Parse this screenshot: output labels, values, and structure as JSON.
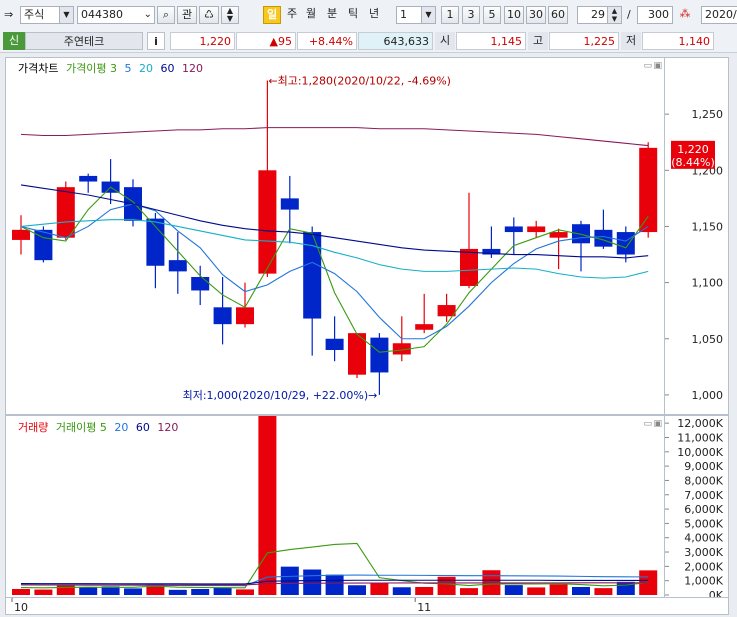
{
  "toolbar": {
    "market_select": "주식",
    "code_input": "044380",
    "search_label": "관",
    "period_buttons": [
      "일",
      "주",
      "월",
      "분",
      "틱",
      "년"
    ],
    "interval_select": "1",
    "interval_buttons": [
      "1",
      "3",
      "5",
      "10",
      "30",
      "60"
    ],
    "count_value": "29",
    "count_total_sep": "/",
    "count_total": "300",
    "date_field": "2020/"
  },
  "info": {
    "credit_badge": "신",
    "stock_name": "주연테크",
    "info_button": "i",
    "price": "1,220",
    "change": "▲95",
    "change_pct": "+8.44%",
    "volume": "643,633",
    "open_label": "시",
    "open": "1,145",
    "high_label": "고",
    "high": "1,225",
    "low_label": "저",
    "low": "1,140"
  },
  "colors": {
    "up": "#e8000b",
    "down": "#0025c8",
    "ma3": "#3a9a10",
    "ma5": "#2276d9",
    "ma20": "#14b0c8",
    "ma60": "#000a8c",
    "ma120": "#8a1a5a",
    "vol_ma5": "#3a9a10"
  },
  "price_panel": {
    "legend": [
      {
        "text": "가격차트",
        "color": "#000000"
      },
      {
        "text": "가격이평 3",
        "color": "#3a9a10"
      },
      {
        "text": "5",
        "color": "#2276d9"
      },
      {
        "text": "20",
        "color": "#14b0c8"
      },
      {
        "text": "60",
        "color": "#000a8c"
      },
      {
        "text": "120",
        "color": "#8a1a5a"
      }
    ],
    "max_annotation": "←최고:1,280(2020/10/22, -4.69%)",
    "min_annotation": "최저:1,000(2020/10/29, +22.00%)→",
    "last_price_label": "1,220",
    "last_pct_label": "(8.44%)"
  },
  "volume_panel": {
    "legend": [
      {
        "text": "거래량",
        "color": "#e8000b"
      },
      {
        "text": "거래이평 5",
        "color": "#3a9a10"
      },
      {
        "text": "20",
        "color": "#2276d9"
      },
      {
        "text": "60",
        "color": "#000a8c"
      },
      {
        "text": "120",
        "color": "#8a1a5a"
      }
    ]
  },
  "x_axis_labels": [
    {
      "text": "10",
      "index": 0
    },
    {
      "text": "11",
      "index": 18
    }
  ],
  "chart_data": [
    {
      "type": "candlestick",
      "title": "가격차트",
      "ylim": [
        983,
        1300
      ],
      "yticks": [
        1000,
        1050,
        1100,
        1150,
        1200,
        1250
      ],
      "ytick_labels": [
        "1,000",
        "1,050",
        "1,100",
        "1,150",
        "1,200",
        "1,250"
      ],
      "candles": [
        {
          "o": 1138,
          "h": 1160,
          "l": 1125,
          "c": 1147
        },
        {
          "o": 1147,
          "h": 1150,
          "l": 1118,
          "c": 1120
        },
        {
          "o": 1140,
          "h": 1190,
          "l": 1138,
          "c": 1185
        },
        {
          "o": 1195,
          "h": 1197,
          "l": 1180,
          "c": 1190
        },
        {
          "o": 1190,
          "h": 1210,
          "l": 1170,
          "c": 1180
        },
        {
          "o": 1185,
          "h": 1192,
          "l": 1150,
          "c": 1155
        },
        {
          "o": 1157,
          "h": 1162,
          "l": 1095,
          "c": 1115
        },
        {
          "o": 1120,
          "h": 1145,
          "l": 1090,
          "c": 1110
        },
        {
          "o": 1105,
          "h": 1115,
          "l": 1080,
          "c": 1093
        },
        {
          "o": 1078,
          "h": 1105,
          "l": 1045,
          "c": 1063
        },
        {
          "o": 1063,
          "h": 1100,
          "l": 1060,
          "c": 1078
        },
        {
          "o": 1108,
          "h": 1280,
          "l": 1105,
          "c": 1200
        },
        {
          "o": 1175,
          "h": 1195,
          "l": 1135,
          "c": 1165
        },
        {
          "o": 1145,
          "h": 1150,
          "l": 1035,
          "c": 1068
        },
        {
          "o": 1050,
          "h": 1070,
          "l": 1030,
          "c": 1040
        },
        {
          "o": 1018,
          "h": 1055,
          "l": 1015,
          "c": 1055
        },
        {
          "o": 1051,
          "h": 1055,
          "l": 1000,
          "c": 1020
        },
        {
          "o": 1036,
          "h": 1070,
          "l": 1030,
          "c": 1046
        },
        {
          "o": 1058,
          "h": 1090,
          "l": 1055,
          "c": 1063
        },
        {
          "o": 1070,
          "h": 1090,
          "l": 1065,
          "c": 1080
        },
        {
          "o": 1097,
          "h": 1180,
          "l": 1095,
          "c": 1130
        },
        {
          "o": 1130,
          "h": 1150,
          "l": 1122,
          "c": 1125
        },
        {
          "o": 1150,
          "h": 1158,
          "l": 1125,
          "c": 1145
        },
        {
          "o": 1145,
          "h": 1155,
          "l": 1140,
          "c": 1150
        },
        {
          "o": 1140,
          "h": 1148,
          "l": 1112,
          "c": 1145
        },
        {
          "o": 1152,
          "h": 1155,
          "l": 1110,
          "c": 1135
        },
        {
          "o": 1147,
          "h": 1165,
          "l": 1130,
          "c": 1132
        },
        {
          "o": 1145,
          "h": 1150,
          "l": 1118,
          "c": 1125
        },
        {
          "o": 1145,
          "h": 1225,
          "l": 1140,
          "c": 1220
        }
      ],
      "series": [
        {
          "name": "3",
          "values": [
            1150,
            1140,
            1137,
            1165,
            1185,
            1172,
            1150,
            1128,
            1106,
            1089,
            1078,
            1113,
            1148,
            1144,
            1091,
            1054,
            1038,
            1040,
            1043,
            1063,
            1091,
            1112,
            1133,
            1140,
            1147,
            1143,
            1138,
            1131,
            1159
          ]
        },
        {
          "name": "5",
          "values": [
            1150,
            1145,
            1140,
            1150,
            1165,
            1170,
            1164,
            1146,
            1131,
            1107,
            1092,
            1098,
            1110,
            1118,
            1108,
            1092,
            1069,
            1050,
            1050,
            1061,
            1079,
            1100,
            1117,
            1130,
            1137,
            1140,
            1141,
            1137,
            1150
          ]
        },
        {
          "name": "20",
          "values": [
            1150,
            1152,
            1154,
            1155,
            1156,
            1156,
            1154,
            1150,
            1146,
            1142,
            1138,
            1137,
            1136,
            1133,
            1127,
            1122,
            1116,
            1112,
            1110,
            1110,
            1111,
            1112,
            1113,
            1112,
            1108,
            1105,
            1104,
            1105,
            1110
          ]
        },
        {
          "name": "60",
          "values": [
            1187,
            1184,
            1181,
            1178,
            1174,
            1170,
            1165,
            1160,
            1155,
            1151,
            1148,
            1146,
            1145,
            1143,
            1140,
            1137,
            1134,
            1131,
            1129,
            1128,
            1127,
            1126,
            1125,
            1125,
            1124,
            1123,
            1123,
            1122,
            1124
          ]
        },
        {
          "name": "120",
          "values": [
            1232,
            1231,
            1231,
            1232,
            1233,
            1234,
            1235,
            1236,
            1236,
            1237,
            1237,
            1238,
            1238,
            1238,
            1238,
            1238,
            1237,
            1237,
            1237,
            1236,
            1235,
            1234,
            1233,
            1232,
            1230,
            1228,
            1226,
            1224,
            1222
          ]
        }
      ]
    },
    {
      "type": "bar",
      "title": "거래량",
      "ylim": [
        0,
        12500
      ],
      "yticks": [
        0,
        1000,
        2000,
        3000,
        4000,
        5000,
        6000,
        7000,
        8000,
        9000,
        10000,
        11000,
        12000
      ],
      "ytick_labels": [
        "0K",
        "1,000K",
        "2,000K",
        "3,000K",
        "4,000K",
        "5,000K",
        "6,000K",
        "7,000K",
        "8,000K",
        "9,000K",
        "10,000K",
        "11,000K",
        "12,000K"
      ],
      "values": [
        420,
        380,
        720,
        540,
        600,
        460,
        780,
        360,
        420,
        530,
        390,
        12600,
        1980,
        1780,
        1420,
        680,
        860,
        540,
        560,
        1270,
        480,
        1730,
        690,
        530,
        740,
        560,
        480,
        920,
        1720
      ],
      "up": [
        true,
        true,
        true,
        false,
        false,
        false,
        true,
        false,
        false,
        false,
        true,
        true,
        false,
        false,
        false,
        false,
        true,
        false,
        true,
        true,
        true,
        true,
        false,
        true,
        true,
        false,
        true,
        false,
        true
      ],
      "series": [
        {
          "name": "5",
          "values": [
            520,
            505,
            530,
            546,
            532,
            540,
            620,
            548,
            524,
            510,
            500,
            2940,
            3170,
            3350,
            3530,
            3600,
            1210,
            1010,
            820,
            780,
            660,
            770,
            770,
            770,
            790,
            730,
            640,
            690,
            880
          ]
        },
        {
          "name": "20",
          "values": [
            700,
            690,
            690,
            680,
            680,
            680,
            670,
            670,
            660,
            660,
            650,
            1250,
            1300,
            1350,
            1380,
            1390,
            1380,
            1380,
            1370,
            1360,
            1350,
            1350,
            1340,
            1330,
            1320,
            1300,
            1280,
            1270,
            1260
          ]
        },
        {
          "name": "60",
          "values": [
            800,
            795,
            790,
            790,
            785,
            780,
            780,
            780,
            775,
            770,
            770,
            960,
            990,
            1010,
            1020,
            1030,
            1030,
            1030,
            1030,
            1030,
            1030,
            1030,
            1030,
            1030,
            1020,
            1020,
            1020,
            1020,
            1020
          ]
        },
        {
          "name": "120",
          "values": [
            720,
            718,
            716,
            714,
            712,
            710,
            708,
            706,
            704,
            702,
            700,
            800,
            810,
            820,
            830,
            835,
            838,
            840,
            841,
            842,
            843,
            844,
            845,
            846,
            847,
            848,
            849,
            850,
            851
          ]
        }
      ]
    }
  ]
}
